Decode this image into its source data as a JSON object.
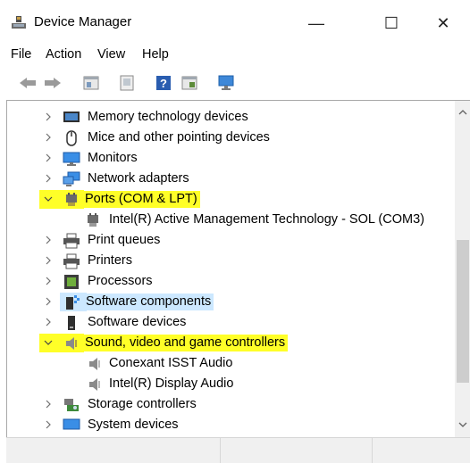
{
  "window": {
    "title": "Device Manager",
    "controls": {
      "minimize": "—",
      "maximize": "☐",
      "close": "✕"
    }
  },
  "menu": [
    "File",
    "Action",
    "View",
    "Help"
  ],
  "toolbar": [
    "back-icon",
    "forward-icon",
    "properties-icon",
    "update-driver-icon",
    "help-icon",
    "view-icon",
    "scan-hardware-icon"
  ],
  "tree": [
    {
      "label": "Memory technology devices",
      "level": 0,
      "expanded": false,
      "icon": "memory-icon",
      "highlight": ""
    },
    {
      "label": "Mice and other pointing devices",
      "level": 0,
      "expanded": false,
      "icon": "mouse-icon",
      "highlight": ""
    },
    {
      "label": "Monitors",
      "level": 0,
      "expanded": false,
      "icon": "monitor-icon",
      "highlight": ""
    },
    {
      "label": "Network adapters",
      "level": 0,
      "expanded": false,
      "icon": "network-icon",
      "highlight": ""
    },
    {
      "label": "Ports (COM & LPT)",
      "level": 0,
      "expanded": true,
      "icon": "port-icon",
      "highlight": "yellow"
    },
    {
      "label": "Intel(R) Active Management Technology - SOL (COM3)",
      "level": 1,
      "expanded": null,
      "icon": "port-icon",
      "highlight": ""
    },
    {
      "label": "Print queues",
      "level": 0,
      "expanded": false,
      "icon": "printer-icon",
      "highlight": ""
    },
    {
      "label": "Printers",
      "level": 0,
      "expanded": false,
      "icon": "printer-icon",
      "highlight": ""
    },
    {
      "label": "Processors",
      "level": 0,
      "expanded": false,
      "icon": "processor-icon",
      "highlight": ""
    },
    {
      "label": "Software components",
      "level": 0,
      "expanded": false,
      "icon": "software-component-icon",
      "highlight": "blue"
    },
    {
      "label": "Software devices",
      "level": 0,
      "expanded": false,
      "icon": "software-device-icon",
      "highlight": ""
    },
    {
      "label": "Sound, video and game controllers",
      "level": 0,
      "expanded": true,
      "icon": "speaker-icon",
      "highlight": "yellow"
    },
    {
      "label": "Conexant ISST Audio",
      "level": 1,
      "expanded": null,
      "icon": "speaker-icon",
      "highlight": ""
    },
    {
      "label": "Intel(R) Display Audio",
      "level": 1,
      "expanded": null,
      "icon": "speaker-icon",
      "highlight": ""
    },
    {
      "label": "Storage controllers",
      "level": 0,
      "expanded": false,
      "icon": "storage-icon",
      "highlight": ""
    },
    {
      "label": "System devices",
      "level": 0,
      "expanded": false,
      "icon": "system-icon",
      "highlight": ""
    }
  ],
  "colors": {
    "highlight_yellow": "#ffff28",
    "highlight_blue": "#cce8ff",
    "chevron": "#6e6e6e"
  }
}
